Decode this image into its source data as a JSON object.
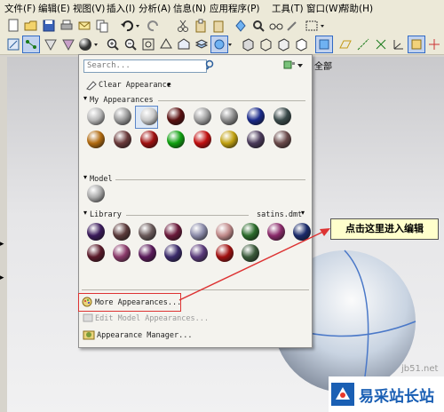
{
  "menubar": {
    "items": [
      "文件(F)",
      "编辑(E)",
      "视图(V)",
      "插入(I)",
      "分析(A)",
      "信息(N)",
      "应用程序(P)",
      "工具(T)",
      "窗口(W)",
      "帮助(H)"
    ]
  },
  "tab_label": "全部",
  "popup": {
    "search_placeholder": "Search...",
    "clear_appearance": "Clear Appearance",
    "my_appearances": "My Appearances",
    "model": "Model",
    "library": "Library",
    "library_file": "satins.dmt",
    "more_appearances": "More Appearances...",
    "edit_model_appearances": "Edit Model Appearances...",
    "appearance_manager": "Appearance Manager..."
  },
  "callout": "点击这里进入编辑",
  "watermark": "jb51.net",
  "logo_text": "易采站长站",
  "colors": {
    "highlight": "#316ac5",
    "callout_bg": "#ffffcc",
    "annotation_red": "#dd3333"
  }
}
